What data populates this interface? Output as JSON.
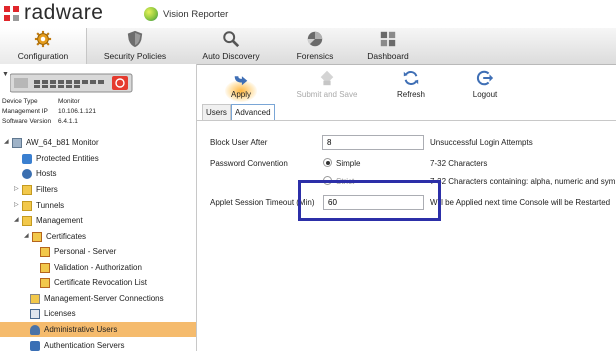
{
  "header": {
    "brand": "radware",
    "product": "Vision Reporter"
  },
  "nav": {
    "items": [
      {
        "label": "Configuration",
        "icon": "gear-icon"
      },
      {
        "label": "Security Policies",
        "icon": "shield-icon"
      },
      {
        "label": "Auto Discovery",
        "icon": "magnifier-icon"
      },
      {
        "label": "Forensics",
        "icon": "forensics-icon"
      },
      {
        "label": "Dashboard",
        "icon": "dashboard-icon"
      }
    ]
  },
  "device": {
    "type_label": "Device Type",
    "type_value": "Monitor",
    "ip_label": "Management IP",
    "ip_value": "10.106.1.121",
    "sw_label": "Software Version",
    "sw_value": "6.4.1.1"
  },
  "tree": [
    {
      "label": "AW_64_b81 Monitor",
      "icon": "device-node-icon",
      "toggle": "◢"
    },
    {
      "label": "Protected Entities",
      "icon": "entities-icon",
      "toggle": ""
    },
    {
      "label": "Hosts",
      "icon": "hosts-icon",
      "toggle": ""
    },
    {
      "label": "Filters",
      "icon": "folder-icon",
      "toggle": "▷"
    },
    {
      "label": "Tunnels",
      "icon": "folder-icon",
      "toggle": "▷"
    },
    {
      "label": "Management",
      "icon": "folder-icon",
      "toggle": "◢"
    },
    {
      "label": "Certificates",
      "icon": "certificate-icon",
      "toggle": "◢"
    },
    {
      "label": "Personal - Server",
      "icon": "certificate-icon",
      "toggle": ""
    },
    {
      "label": "Validation - Authorization",
      "icon": "certificate-icon",
      "toggle": ""
    },
    {
      "label": "Certificate Revocation List",
      "icon": "certificate-icon",
      "toggle": ""
    },
    {
      "label": "Management-Server Connections",
      "icon": "connections-icon",
      "toggle": ""
    },
    {
      "label": "Licenses",
      "icon": "license-icon",
      "toggle": ""
    },
    {
      "label": "Administrative Users",
      "icon": "user-icon",
      "toggle": "",
      "selected": true
    },
    {
      "label": "Authentication Servers",
      "icon": "auth-server-icon",
      "toggle": ""
    }
  ],
  "toolbar": {
    "apply": "Apply",
    "submit_save": "Submit and Save",
    "refresh": "Refresh",
    "logout": "Logout"
  },
  "tabs": [
    "Users",
    "Advanced"
  ],
  "form": {
    "block_user_label": "Block User After",
    "block_user_value": "8",
    "block_user_unit": "Unsuccessful Login Attempts",
    "password_label": "Password Convention",
    "opt_simple": "Simple",
    "opt_simple_desc": "7-32 Characters",
    "opt_strict": "Strict",
    "opt_strict_desc": "7-32 Characters containing: alpha, numeric and sym",
    "timeout_label": "Applet Session Timeout (Min)",
    "timeout_value": "60",
    "timeout_note": "Will be Applied next time Console will be Restarted"
  },
  "colors": {
    "selection": "#f5bb6d",
    "highlight_box": "#2c2fa8",
    "logo_red": "#e0262b"
  }
}
